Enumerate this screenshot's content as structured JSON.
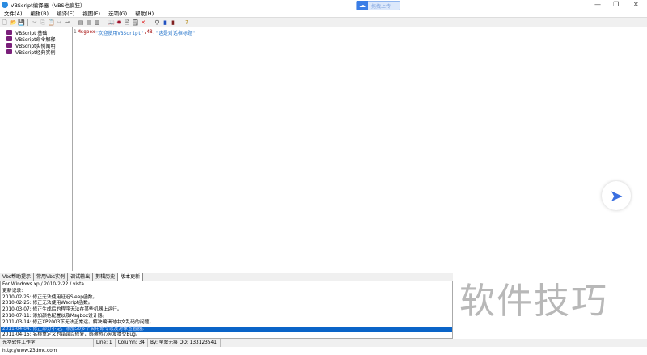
{
  "title": "VBScript编译器（VBS也疯狂）",
  "upload_label": "拖拽上传",
  "window_controls": [
    "—",
    "❐",
    "✕"
  ],
  "menu": [
    "文件(A)",
    "编辑(B)",
    "编译(E)",
    "视图(F)",
    "选项(G)",
    "帮助(H)"
  ],
  "tree": [
    "VBScript 基础",
    "VBScript命令解释",
    "VBScript实例阐明",
    "VBScript经典实例"
  ],
  "editor": {
    "line_number": "1",
    "keyword": "Msgbox",
    "text1": " \"欢迎使用VBScript\"",
    "text2": ",48,",
    "text3": "\"这是对话框标题\""
  },
  "tabs": [
    "Vbs帮助提示",
    "常用Vbs实例",
    "调试输出",
    "剪辑历史",
    "版本更新"
  ],
  "log": [
    "For Windows xp / 2010-2-22 / vista",
    "更新记录:",
    "2010-02-25: 修正无法使用延迟Sleep函数。",
    "2010-02-25: 修正无法使用Wscript函数。",
    "2010-03-07: 修正生成后的程序无法在某些机器上运行。",
    "2010-07-11: 添加颜色配置以及Msgbox设计器。",
    "2011-03-14: 修正XP2003下无法正常运。解决编辑时中文乱码的问题。",
    "2011-04-04: 修正部分不足，添加50多个实用命令以及对象查看器。",
    "2011-04-15: 名称重定义的错误以修复，感谢热心网友提交Bug。"
  ],
  "status": [
    "光华软件工作室: http://www.23dmc.com",
    "Line: 1",
    "Column: 34",
    "By: 萤翠无痕 QQ: 133123541"
  ],
  "watermark": "软件技巧"
}
